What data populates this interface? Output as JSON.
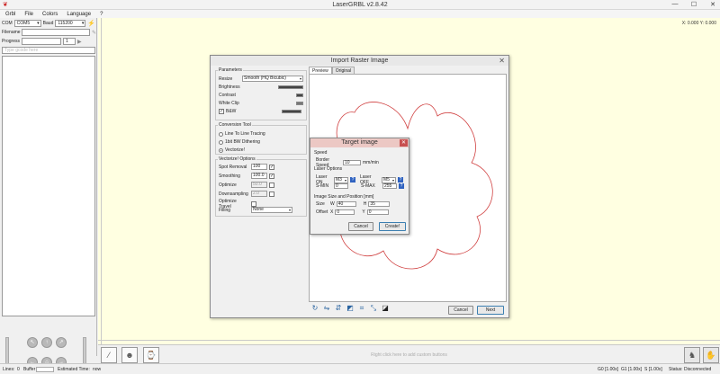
{
  "window": {
    "title": "LaserGRBL v2.8.42",
    "min": "—",
    "max": "☐",
    "close": "✕"
  },
  "menu": [
    "Grbl",
    "File",
    "Colors",
    "Language",
    "?"
  ],
  "left": {
    "com_label": "COM",
    "com_value": "COM5",
    "baud_label": "Baud",
    "baud_value": "115200",
    "filename_label": "Filename",
    "progress_label": "Progress",
    "progress_count": "1",
    "list_placeholder": "Type gcode here"
  },
  "canvas": {
    "coords": "X: 0.000 Y: 0.000"
  },
  "bottom": {
    "hint": "Right click here to add custom buttons"
  },
  "status": {
    "lines_label": "Lines:",
    "lines_value": "0",
    "buffer_label": "Buffer",
    "est_label": "Estimated Time:",
    "est_value": "now",
    "g0": "G0 [1.00x]",
    "g1": "G1 [1.00x]",
    "s": "S [1.00x]",
    "status_label": "Status:",
    "status_value": "Disconnected"
  },
  "dialog": {
    "title": "Import Raster Image",
    "parameters": "Parameters",
    "resize_label": "Resize",
    "resize_value": "Smooth (HQ Bicubic)",
    "brightness": "Brightness",
    "contrast": "Contrast",
    "whiteclip": "White Clip",
    "bw": "B&W",
    "conversion": "Conversion Tool",
    "line_tracing": "Line To Line Tracing",
    "dithering": "1bit BW Dithering",
    "vectorize": "Vectorize!",
    "vector_options": "Vectorize! Options",
    "spot_removal": "Spot Removal",
    "spot_value": "100",
    "smoothing": "Smoothing",
    "smoothing_value": "100.0",
    "optimize": "Optimize",
    "optimize_value": "50.0",
    "downsampling": "Downsampling",
    "downsampling_value": "2.0",
    "optimize_travel": "Optimize Travel",
    "filling": "Filling",
    "filling_value": "None",
    "tab_preview": "Preview",
    "tab_original": "Original",
    "cancel": "Cancel",
    "next": "Next"
  },
  "target": {
    "title": "Target image",
    "speed_section": "Speed",
    "border_speed_label": "Border Speed",
    "border_speed_value": "10",
    "speed_unit": "mm/min",
    "laser_section": "Laser Options",
    "laser_on_label": "Laser ON",
    "laser_on_value": "M3",
    "laser_off_label": "Laser OFF",
    "laser_off_value": "M5",
    "smin_label": "S-MIN",
    "smin_value": "0",
    "smax_label": "S-MAX",
    "smax_value": "255",
    "size_section": "Image Size and Position [mm]",
    "size_label": "Size",
    "w_label": "W",
    "w_value": "40",
    "h_label": "H",
    "h_value": "35",
    "offset_label": "Offset",
    "x_label": "X",
    "x_value": "0",
    "y_label": "Y",
    "y_value": "0",
    "cancel": "Cancel",
    "create": "Create!"
  }
}
